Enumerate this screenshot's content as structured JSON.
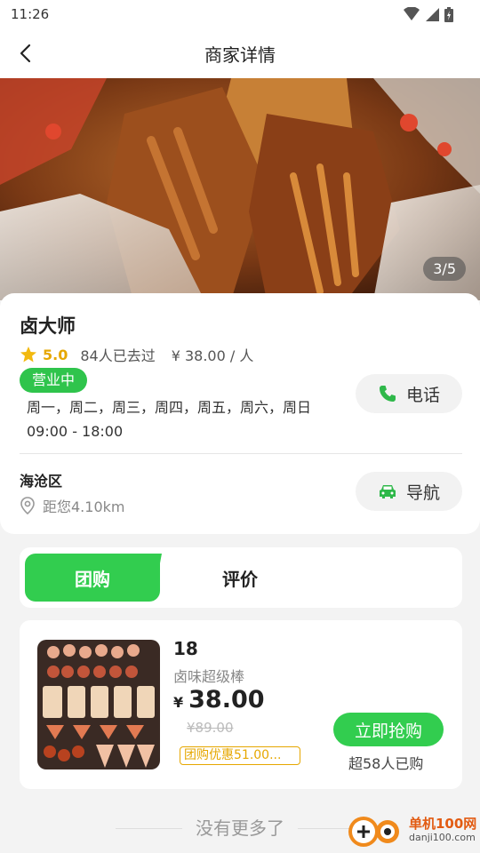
{
  "status_bar": {
    "time": "11:26"
  },
  "nav": {
    "title": "商家详情"
  },
  "hero": {
    "counter": "3/5"
  },
  "shop": {
    "name": "卤大师",
    "rating": "5.0",
    "visits": "84人已去过",
    "price_per_person": "¥ 38.00 / 人",
    "status": "营业中",
    "weekdays": "周一，周二，周三，周四，周五，周六，周日",
    "hours": "09:00 - 18:00",
    "call_label": "电话",
    "district": "海沧区",
    "distance": "距您4.10km",
    "navigate_label": "导航"
  },
  "tabs": [
    {
      "label": "团购",
      "active": true
    },
    {
      "label": "评价",
      "active": false
    }
  ],
  "deal": {
    "title": "18",
    "subtitle": "卤味超级棒",
    "currency": "¥",
    "price": "38.00",
    "original_price": "¥89.00",
    "discount": "团购优惠51.00...",
    "buy_label": "立即抢购",
    "sold": "超58人已购"
  },
  "footer": {
    "no_more": "没有更多了"
  },
  "watermark": {
    "name": "单机100网",
    "url": "danji100.com"
  },
  "colors": {
    "accent": "#32cd4f",
    "rating": "#e6a700"
  }
}
